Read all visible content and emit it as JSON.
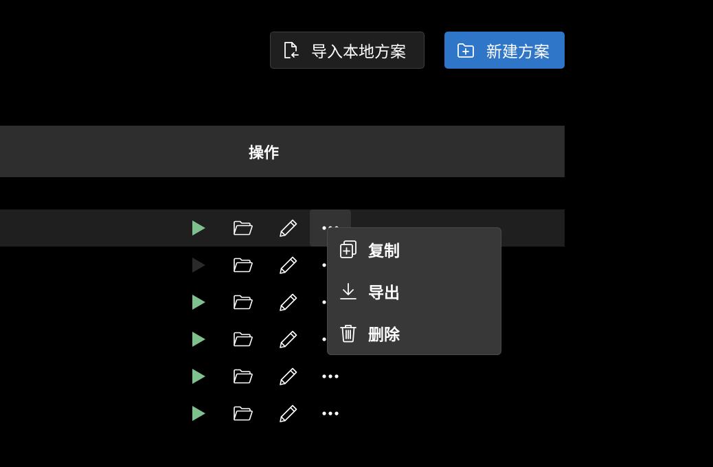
{
  "toolbar": {
    "import_label": "导入本地方案",
    "new_label": "新建方案"
  },
  "table": {
    "header_operations": "操作",
    "rows": [
      {
        "play_enabled": true,
        "hover": true
      },
      {
        "play_enabled": false,
        "hover": false
      },
      {
        "play_enabled": true,
        "hover": false
      },
      {
        "play_enabled": true,
        "hover": false
      },
      {
        "play_enabled": true,
        "hover": false
      },
      {
        "play_enabled": true,
        "hover": false
      }
    ]
  },
  "menu": {
    "items": [
      {
        "label": "复制",
        "icon": "copy-icon"
      },
      {
        "label": "导出",
        "icon": "download-icon"
      },
      {
        "label": "删除",
        "icon": "trash-icon"
      }
    ]
  },
  "colors": {
    "background": "#000000",
    "primary": "#2f76c8",
    "play_enabled": "#7fc08f",
    "play_disabled": "#2a2a2a",
    "header_bg": "#2e2e2e",
    "menu_bg": "#383838"
  }
}
